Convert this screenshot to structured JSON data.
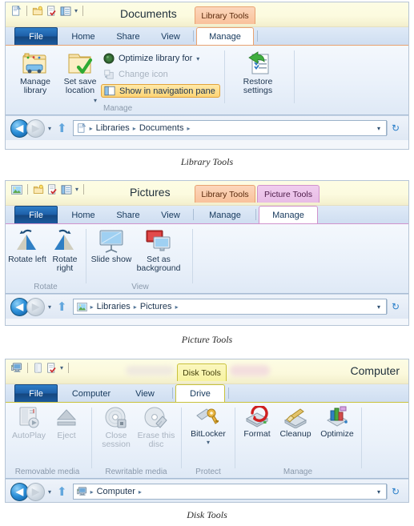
{
  "panels": [
    {
      "id": "documents",
      "caption": "Library Tools",
      "title": "Documents",
      "contextual_groups": [
        {
          "label": "Library Tools",
          "color": "#f9c19b"
        }
      ],
      "tabs": [
        {
          "label": "File",
          "state": "file"
        },
        {
          "label": "Home",
          "state": "normal"
        },
        {
          "label": "Share",
          "state": "normal"
        },
        {
          "label": "View",
          "state": "normal"
        },
        {
          "label": "Manage",
          "state": "active"
        }
      ],
      "ribbon_groups": [
        {
          "label": "Manage",
          "big_buttons": [
            {
              "label": "Manage library",
              "icon": "manage-library-icon",
              "enabled": true
            },
            {
              "label": "Set save location",
              "icon": "set-save-location-icon",
              "enabled": true,
              "dropdown": true
            }
          ],
          "small_buttons": [
            {
              "label": "Optimize library for",
              "icon": "optimize-library-icon",
              "enabled": true,
              "dropdown": true,
              "highlighted": false
            },
            {
              "label": "Change icon",
              "icon": "change-icon-icon",
              "enabled": false,
              "dropdown": false,
              "highlighted": false
            },
            {
              "label": "Show in navigation pane",
              "icon": "navigation-pane-icon",
              "enabled": true,
              "dropdown": false,
              "highlighted": true
            }
          ]
        },
        {
          "label": "",
          "big_buttons": [
            {
              "label": "Restore settings",
              "icon": "restore-settings-icon",
              "enabled": true
            }
          ],
          "small_buttons": []
        }
      ],
      "address": {
        "back_label": "Back",
        "forward_label": "Forward",
        "up_label": "Up",
        "crumbs": [
          "Libraries",
          "Documents"
        ],
        "location_icon": "documents-library-icon",
        "refresh_label": "Refresh"
      }
    },
    {
      "id": "pictures",
      "caption": "Picture Tools",
      "title": "Pictures",
      "contextual_groups": [
        {
          "label": "Library Tools",
          "color": "#f9c19b"
        },
        {
          "label": "Picture Tools",
          "color": "#e8bce6"
        }
      ],
      "tabs": [
        {
          "label": "File",
          "state": "file"
        },
        {
          "label": "Home",
          "state": "normal"
        },
        {
          "label": "Share",
          "state": "normal"
        },
        {
          "label": "View",
          "state": "normal"
        },
        {
          "label": "Manage",
          "state": "normal"
        },
        {
          "label": "Manage",
          "state": "active"
        }
      ],
      "ribbon_groups": [
        {
          "label": "Rotate",
          "big_buttons": [
            {
              "label": "Rotate left",
              "icon": "rotate-left-icon",
              "enabled": true
            },
            {
              "label": "Rotate right",
              "icon": "rotate-right-icon",
              "enabled": true
            }
          ],
          "small_buttons": []
        },
        {
          "label": "View",
          "big_buttons": [
            {
              "label": "Slide show",
              "icon": "slide-show-icon",
              "enabled": true
            },
            {
              "label": "Set as background",
              "icon": "set-as-background-icon",
              "enabled": true
            }
          ],
          "small_buttons": []
        }
      ],
      "address": {
        "back_label": "Back",
        "forward_label": "Forward",
        "up_label": "Up",
        "crumbs": [
          "Libraries",
          "Pictures"
        ],
        "location_icon": "pictures-library-icon",
        "refresh_label": "Refresh"
      }
    },
    {
      "id": "computer",
      "caption": "Disk Tools",
      "title": "Computer",
      "contextual_groups": [
        {
          "label": "Disk Tools",
          "color": "#f7f39f"
        }
      ],
      "tabs": [
        {
          "label": "File",
          "state": "file"
        },
        {
          "label": "Computer",
          "state": "normal"
        },
        {
          "label": "View",
          "state": "normal"
        },
        {
          "label": "Drive",
          "state": "active"
        }
      ],
      "ribbon_groups": [
        {
          "label": "Removable media",
          "big_buttons": [
            {
              "label": "AutoPlay",
              "icon": "autoplay-icon",
              "enabled": false
            },
            {
              "label": "Eject",
              "icon": "eject-icon",
              "enabled": false
            }
          ],
          "small_buttons": []
        },
        {
          "label": "Rewritable media",
          "big_buttons": [
            {
              "label": "Close session",
              "icon": "close-session-icon",
              "enabled": false
            },
            {
              "label": "Erase this disc",
              "icon": "erase-disc-icon",
              "enabled": false
            }
          ],
          "small_buttons": []
        },
        {
          "label": "Protect",
          "big_buttons": [
            {
              "label": "BitLocker",
              "icon": "bitlocker-icon",
              "enabled": true,
              "dropdown": true
            }
          ],
          "small_buttons": []
        },
        {
          "label": "Manage",
          "big_buttons": [
            {
              "label": "Format",
              "icon": "format-icon",
              "enabled": true
            },
            {
              "label": "Cleanup",
              "icon": "cleanup-icon",
              "enabled": true
            },
            {
              "label": "Optimize",
              "icon": "optimize-icon",
              "enabled": true
            }
          ],
          "small_buttons": []
        }
      ],
      "address": {
        "back_label": "Back",
        "forward_label": "Forward",
        "up_label": "Up",
        "crumbs": [
          "Computer"
        ],
        "location_icon": "computer-icon",
        "refresh_label": "Refresh"
      }
    }
  ],
  "quick_access": {
    "customize_caret": "▾",
    "items": [
      "properties-icon",
      "new-folder-icon",
      "new-item-icon",
      "preview-pane-icon"
    ]
  },
  "glyphs": {
    "crumb_sep": "▸",
    "caret_down": "▾",
    "back_arrow": "◀",
    "forward_arrow": "▶",
    "up_arrow": "⬆",
    "refresh": "↻"
  },
  "colors": {
    "file_tab": "#1d5fa8",
    "library_tools": "#f9c19b",
    "picture_tools": "#e8bce6",
    "disk_tools": "#f7f39f",
    "highlight": "#fdd475"
  }
}
